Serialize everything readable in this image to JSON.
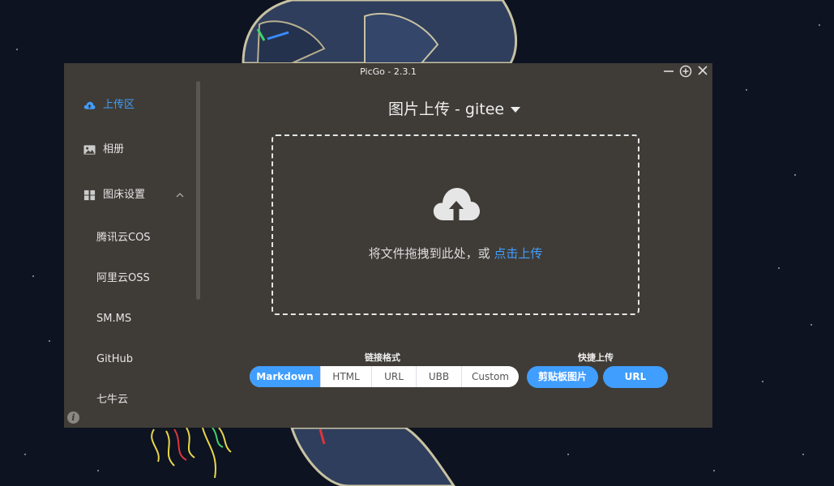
{
  "window": {
    "title": "PicGo - 2.3.1"
  },
  "sidebar": {
    "items": [
      {
        "label": "上传区",
        "icon": "upload-cloud-icon",
        "active": true
      },
      {
        "label": "相册",
        "icon": "image-icon"
      },
      {
        "label": "图床设置",
        "icon": "grid-icon",
        "expanded": true
      }
    ],
    "sub_items": [
      "腾讯云COS",
      "阿里云OSS",
      "SM.MS",
      "GitHub",
      "七牛云"
    ],
    "info_icon": "i"
  },
  "main": {
    "title": "图片上传 - gitee",
    "drop_text": "将文件拖拽到此处，或 ",
    "drop_link": "点击上传",
    "link_format": {
      "label": "链接格式",
      "options": [
        "Markdown",
        "HTML",
        "URL",
        "UBB",
        "Custom"
      ],
      "selected": "Markdown"
    },
    "quick_upload": {
      "label": "快捷上传",
      "buttons": [
        "剪贴板图片",
        "URL"
      ]
    }
  },
  "colors": {
    "accent": "#409eff",
    "window_bg": "#3f3c37",
    "desktop_bg": "#0d1320"
  }
}
